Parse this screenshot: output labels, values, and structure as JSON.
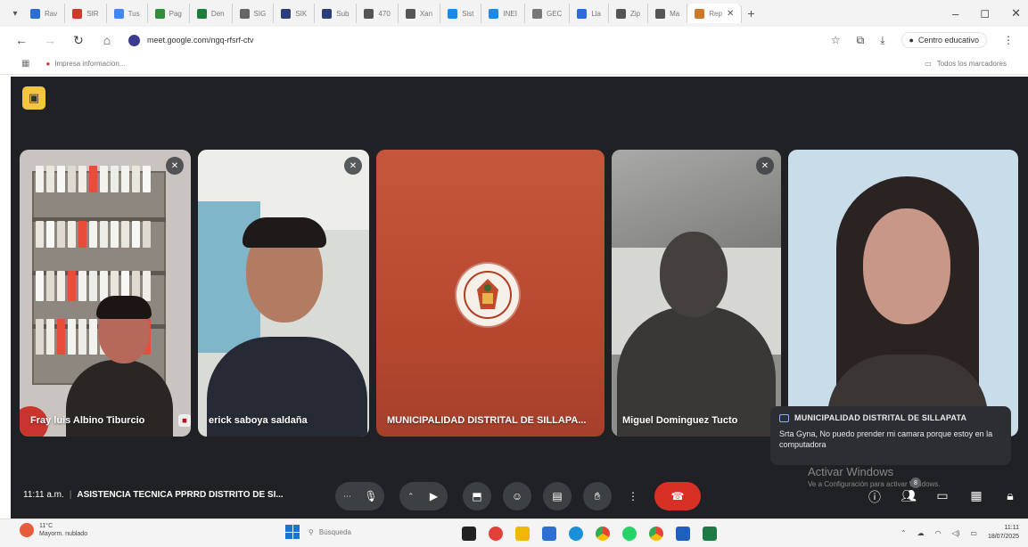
{
  "browser": {
    "tabs": [
      {
        "label": "Rav",
        "color": "#2b6cd6"
      },
      {
        "label": "SIR",
        "color": "#cc3a2a"
      },
      {
        "label": "Tus",
        "color": "#4285f4"
      },
      {
        "label": "Pag",
        "color": "#2f8f3a"
      },
      {
        "label": "Den",
        "color": "#1a7f37"
      },
      {
        "label": "SIG",
        "color": "#666666"
      },
      {
        "label": "SIK",
        "color": "#2c3e7a"
      },
      {
        "label": "Sub",
        "color": "#2c3e7a"
      },
      {
        "label": "470",
        "color": "#555555"
      },
      {
        "label": "Xan",
        "color": "#555555"
      },
      {
        "label": "Sist",
        "color": "#1e88e5"
      },
      {
        "label": "INEI",
        "color": "#1e88e5"
      },
      {
        "label": "GEC",
        "color": "#777777"
      },
      {
        "label": "Lla",
        "color": "#2b6cd6"
      },
      {
        "label": "Zip",
        "color": "#555555"
      },
      {
        "label": "Ma",
        "color": "#555555"
      },
      {
        "label": "Rep",
        "color": "#cc7a2a"
      }
    ],
    "new_tab_label": "+",
    "url": "meet.google.com/ngq-rfsrf-ctv",
    "profile_label": "Centro educativo",
    "bookmark_left": "Impresa informacion...",
    "bookmark_right": "Todos los marcadores"
  },
  "meet": {
    "time": "11:11 a.m.",
    "meeting_title": "ASISTENCIA TECNICA PPRRD DISTRITO DE SI...",
    "participants": [
      {
        "name": "Fray luis Albino Tiburcio",
        "muted": true
      },
      {
        "name": "erick saboya saldaña",
        "muted": true
      },
      {
        "name": "MUNICIPALIDAD DISTRITAL DE SILLAPA...",
        "muted": false
      },
      {
        "name": "Miguel Dominguez Tucto",
        "muted": true
      },
      {
        "name": "",
        "muted": false
      }
    ],
    "participant_count": "8",
    "chat_toast": {
      "sender": "MUNICIPALIDAD DISTRITAL DE SILLAPATA",
      "message": "Srta Gyna, No puedo prender mi camara porque estoy en la computadora"
    },
    "colors": {
      "stage": "#202124",
      "hangup": "#d93025",
      "layout_btn": "#f4c542"
    }
  },
  "watermark": {
    "title": "Activar Windows",
    "subtitle": "Ve a Configuración para activar Windows."
  },
  "taskbar": {
    "weather_temp": "11°C",
    "weather_desc": "Mayorm. nublado",
    "search_placeholder": "Búsqueda",
    "clock_time": "11:11",
    "clock_date": "18/07/2025"
  }
}
